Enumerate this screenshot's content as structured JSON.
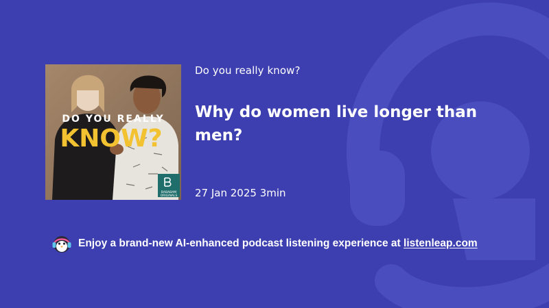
{
  "podcast": {
    "show_name": "Do you really know?",
    "episode_title": "Why do women live longer than men?",
    "date": "27 Jan 2025",
    "duration": "3min",
    "cover": {
      "line1": "DO YOU REALLY",
      "line2": "KNOW?",
      "badge_line1": "BABABAM",
      "badge_line2": "ORIGINALS"
    }
  },
  "promo": {
    "text": "Enjoy a brand-new AI-enhanced podcast listening experience at",
    "link_label": "listenleap.com",
    "icon": "penguin-headphones-icon"
  },
  "colors": {
    "background": "#3d3fb0",
    "watermark": "#4a4dbe",
    "cover_title_yellow": "#f2c230",
    "badge_green": "#1f6e6b"
  }
}
